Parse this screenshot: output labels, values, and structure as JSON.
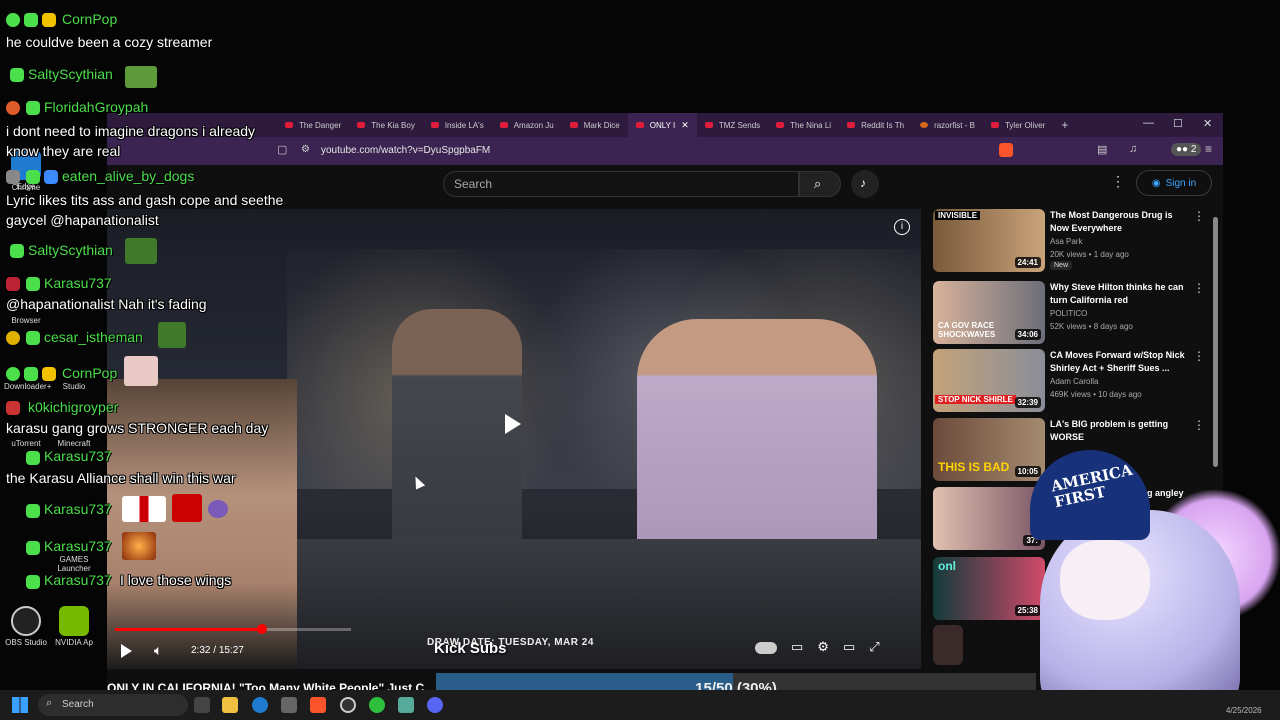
{
  "browser": {
    "tabs": [
      {
        "label": "The Danger"
      },
      {
        "label": "The Kia Boy"
      },
      {
        "label": "Inside LA's"
      },
      {
        "label": "Amazon Ju"
      },
      {
        "label": "Mark Dice"
      },
      {
        "label": "ONLY I"
      },
      {
        "label": "TMZ Sends"
      },
      {
        "label": "The Nina Li"
      },
      {
        "label": "Reddit Is Th"
      },
      {
        "label": "razorfist - B"
      },
      {
        "label": "Tyler Oliver"
      }
    ],
    "url": "youtube.com/watch?v=DyuSpgpbaFM",
    "extension_count": "2"
  },
  "youtube": {
    "search_placeholder": "Search",
    "sign_in": "Sign in",
    "video_title": "ONLY IN CALIFORNIA! \"Too Many White People\" Just C",
    "time_current": "2:32",
    "time_total": "15:27",
    "progress_fraction": 0.164,
    "lower_third": "DRAW DATE:  TUESDAY, MAR 24",
    "recommendations": [
      {
        "title": "The Most Dangerous Drug is Now Everywhere",
        "channel": "Asa Park",
        "meta": "20K views • 1 day ago",
        "duration": "24:41",
        "badge": "New",
        "thumb_tag": "INVISIBLE"
      },
      {
        "title": "Why Steve Hilton thinks he can turn California red",
        "channel": "POLITICO",
        "meta": "52K views • 8 days ago",
        "duration": "34:06",
        "thumb_tag": "CA GOV RACE SHOCKWAVES"
      },
      {
        "title": "CA Moves Forward w/Stop Nick Shirley Act + Sheriff Sues ...",
        "channel": "Adam Carolla",
        "meta": "469K views • 10 days ago",
        "duration": "32:39",
        "thumb_tag": "STOP NICK SHIRLE"
      },
      {
        "title": "LA's BIG problem is getting WORSE",
        "channel": "",
        "meta": "",
        "duration": "10:05",
        "thumb_tag": "THIS IS BAD"
      },
      {
        "title": "e trying angley",
        "channel": "",
        "meta": "",
        "duration": "37:",
        "thumb_tag": ""
      },
      {
        "title": "",
        "channel": "",
        "meta": "",
        "duration": "25:38",
        "thumb_tag": "onl"
      }
    ]
  },
  "chat": {
    "messages": [
      {
        "user": "CornPop",
        "text": "he couldve been a cozy streamer"
      },
      {
        "user": "SaltyScythian",
        "text": ""
      },
      {
        "user": "FloridahGroypah",
        "text": "i dont need to imagine dragons i already know they are real"
      },
      {
        "user": "eaten_alive_by_dogs",
        "text": "Lyric likes tits ass and gash cope and seethe gaycel @hapanationalist"
      },
      {
        "user": "SaltyScythian",
        "text": ""
      },
      {
        "user": "Karasu737",
        "text": "@hapanationalist Nah it's fading"
      },
      {
        "user": "cesar_istheman",
        "text": ""
      },
      {
        "user": "CornPop",
        "text": ""
      },
      {
        "user": "k0kichigroyper",
        "text": "karasu gang grows STRONGER each day"
      },
      {
        "user": "Karasu737",
        "text": "the Karasu Alliance shall win this war"
      },
      {
        "user": "Karasu737",
        "text": ""
      },
      {
        "user": "Karasu737",
        "text": ""
      },
      {
        "user": "Karasu737",
        "text": "I love those wings"
      }
    ]
  },
  "overlay": {
    "kick_label": "Kick Subs",
    "goal_text": "15/50 (30%)",
    "goal_fraction": 0.3,
    "hat_text": "AMERICA FIRST"
  },
  "desktop": {
    "icons": [
      "Edge",
      "Chrome",
      "Browser",
      "Downloader+",
      "Studio",
      "uTorrent",
      "Minecraft",
      "GAMES Launcher",
      "OBS Studio",
      "NVIDIA Ap"
    ]
  },
  "taskbar": {
    "search": "Search",
    "date": "4/25/2026"
  },
  "colors": {
    "chat_user": "#4cdf4c",
    "tabbar": "#2d1a3d",
    "goal_fill": "#2b5d8b",
    "yt_red": "#ff0000"
  }
}
